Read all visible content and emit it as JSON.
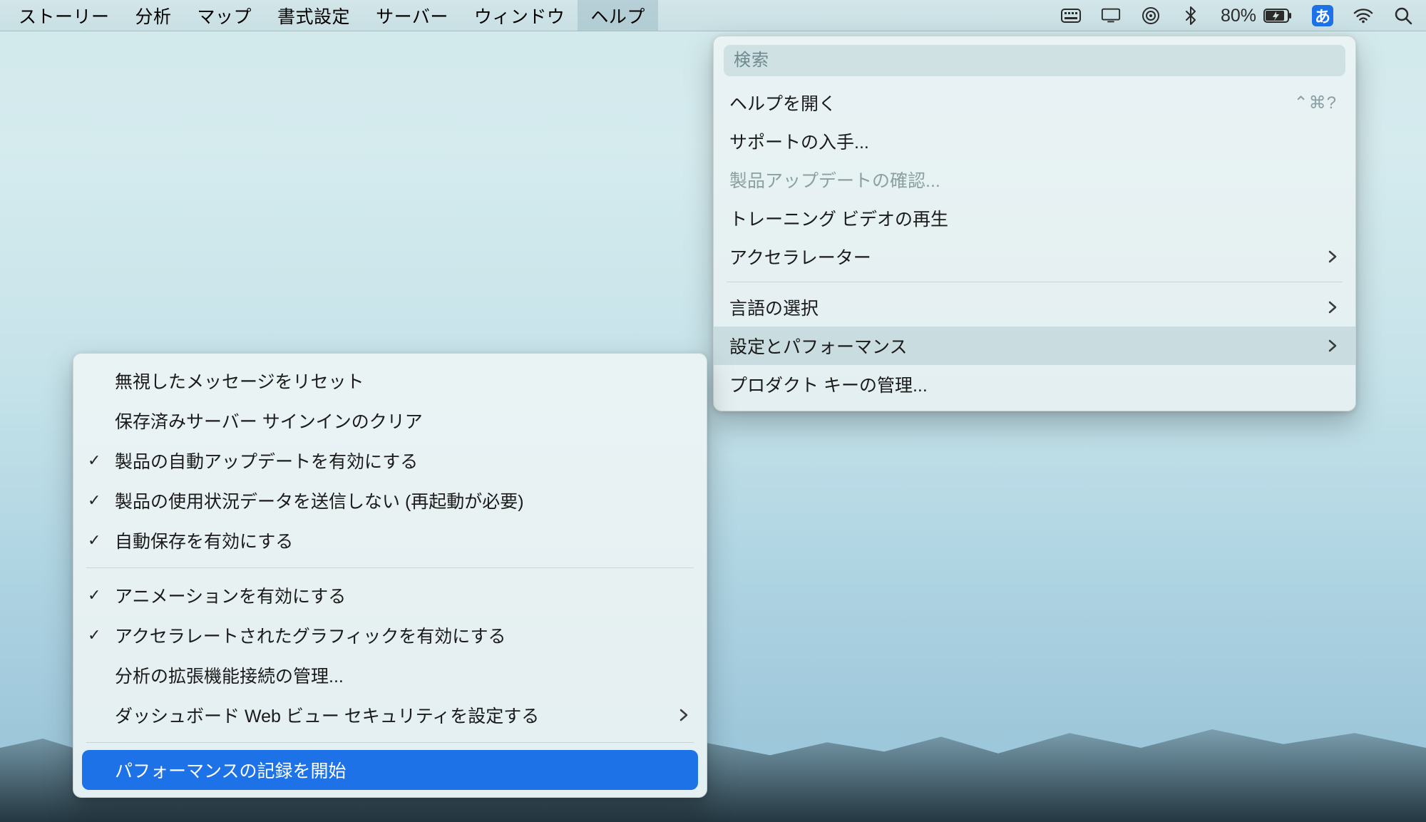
{
  "menubar": {
    "items": [
      {
        "label": "ストーリー"
      },
      {
        "label": "分析"
      },
      {
        "label": "マップ"
      },
      {
        "label": "書式設定"
      },
      {
        "label": "サーバー"
      },
      {
        "label": "ウィンドウ"
      },
      {
        "label": "ヘルプ"
      }
    ],
    "status": {
      "battery_percent": "80%",
      "ime_label": "あ"
    }
  },
  "help_menu": {
    "search_placeholder": "検索",
    "items": [
      {
        "label": "ヘルプを開く",
        "shortcut": "⌃⌘?"
      },
      {
        "label": "サポートの入手..."
      },
      {
        "label": "製品アップデートの確認...",
        "disabled": true
      },
      {
        "label": "トレーニング ビデオの再生"
      },
      {
        "label": "アクセラレーター",
        "submenu": true
      },
      {
        "sep": true
      },
      {
        "label": "言語の選択",
        "submenu": true
      },
      {
        "label": "設定とパフォーマンス",
        "submenu": true,
        "hover": true
      },
      {
        "label": "プロダクト キーの管理..."
      }
    ]
  },
  "settings_submenu": {
    "items": [
      {
        "label": "無視したメッセージをリセット"
      },
      {
        "label": "保存済みサーバー サインインのクリア"
      },
      {
        "label": "製品の自動アップデートを有効にする",
        "checked": true
      },
      {
        "label": "製品の使用状況データを送信しない (再起動が必要)",
        "checked": true
      },
      {
        "label": "自動保存を有効にする",
        "checked": true
      },
      {
        "sep": true
      },
      {
        "label": "アニメーションを有効にする",
        "checked": true
      },
      {
        "label": "アクセラレートされたグラフィックを有効にする",
        "checked": true
      },
      {
        "label": "分析の拡張機能接続の管理..."
      },
      {
        "label": "ダッシュボード Web ビュー セキュリティを設定する",
        "submenu": true
      },
      {
        "sep": true
      },
      {
        "label": "パフォーマンスの記録を開始",
        "selected": true
      }
    ]
  }
}
